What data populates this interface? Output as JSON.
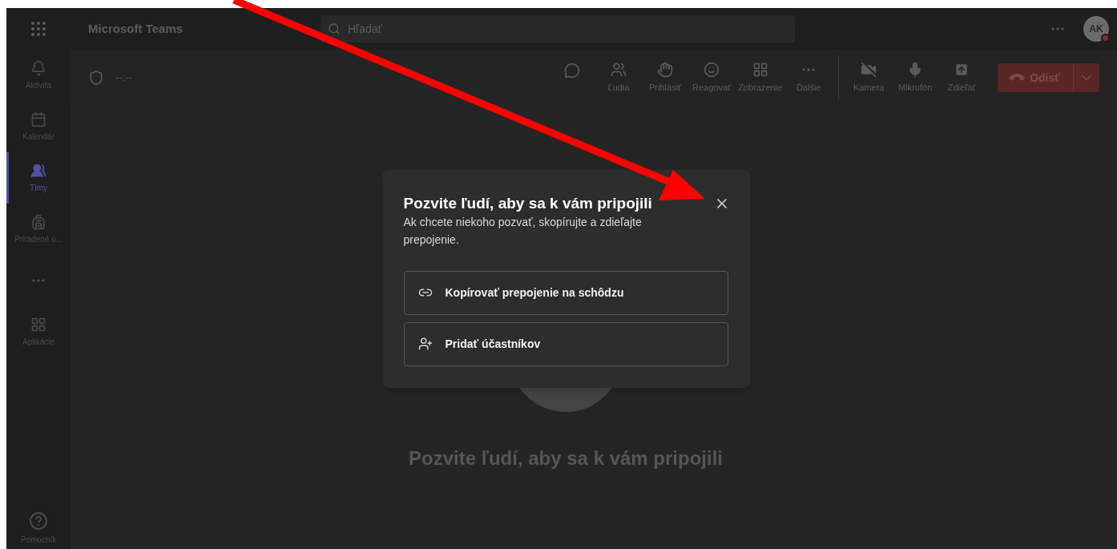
{
  "top_bar": {
    "app_title": "Microsoft Teams",
    "search": {
      "placeholder": "Hľadať"
    },
    "avatar": {
      "initials": "AK"
    }
  },
  "rail": {
    "items": [
      {
        "kind": "bell",
        "label": "Aktivita",
        "selected": false
      },
      {
        "kind": "calendar",
        "label": "Kalendár",
        "selected": false
      },
      {
        "kind": "teams",
        "label": "Tímy",
        "selected": true
      },
      {
        "kind": "backpack",
        "label": "Priradené ú...",
        "selected": false
      },
      {
        "kind": "more"
      },
      {
        "kind": "apps",
        "label": "Aplikácie",
        "selected": false
      }
    ],
    "help": {
      "label": "Pomocník"
    }
  },
  "call_bar": {
    "timer": "--:--",
    "tools": [
      {
        "kind": "chat"
      },
      {
        "kind": "people",
        "label": "Ľudia"
      },
      {
        "kind": "hand",
        "label": "Prihlásiť"
      },
      {
        "kind": "react",
        "label": "Reagovať"
      },
      {
        "kind": "view",
        "label": "Zobrazenie"
      },
      {
        "kind": "more",
        "label": "Ďalšie"
      },
      {
        "kind": "camera",
        "label": "Kamera"
      },
      {
        "kind": "mic",
        "label": "Mikrofón"
      },
      {
        "kind": "share",
        "label": "Zdieľať"
      }
    ],
    "leave": {
      "label": "Odísť"
    }
  },
  "dialog": {
    "title": "Pozvite ľudí, aby sa k vám pripojili",
    "message": "Ak chcete niekoho pozvať, skopírujte a zdieľajte prepojenie.",
    "actions": [
      {
        "kind": "link",
        "label": "Kopírovať prepojenie na schôdzu"
      },
      {
        "kind": "add-people",
        "label": "Pridať účastníkov"
      }
    ]
  },
  "stage": {
    "caption": "Pozvite ľudí, aby sa k vám pripojili"
  }
}
